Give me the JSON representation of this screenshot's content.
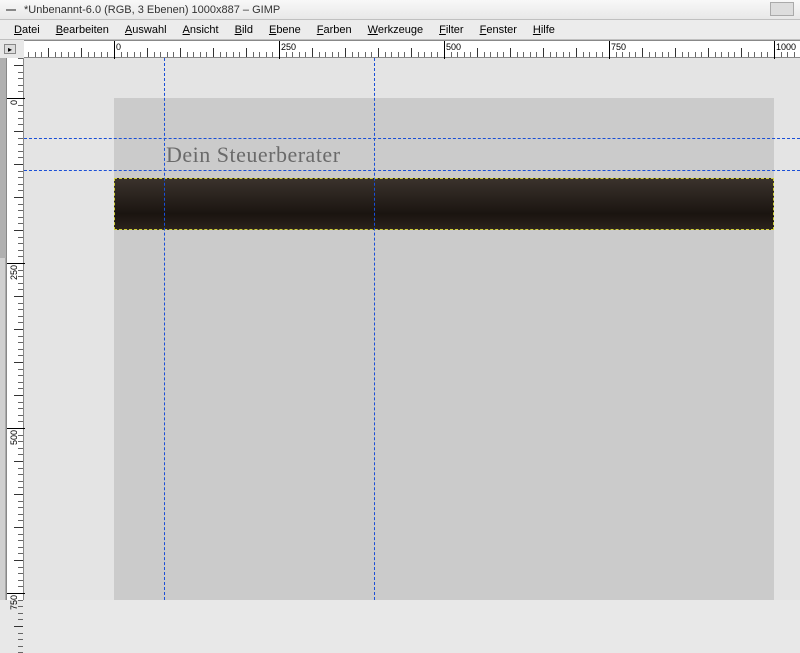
{
  "window": {
    "title": "*Unbenannt-6.0 (RGB, 3 Ebenen) 1000x887 – GIMP"
  },
  "menu": {
    "items": [
      "Datei",
      "Bearbeiten",
      "Auswahl",
      "Ansicht",
      "Bild",
      "Ebene",
      "Farben",
      "Werkzeuge",
      "Filter",
      "Fenster",
      "Hilfe"
    ]
  },
  "ruler_h": {
    "ticks": [
      {
        "pos": 0,
        "label": "0"
      },
      {
        "pos": 250,
        "label": "250"
      },
      {
        "pos": 500,
        "label": "500"
      },
      {
        "pos": 750,
        "label": "750"
      },
      {
        "pos": 1000,
        "label": "1000"
      }
    ]
  },
  "ruler_v": {
    "ticks": [
      {
        "pos": 0,
        "label": "0"
      },
      {
        "pos": 250,
        "label": "250"
      },
      {
        "pos": 500,
        "label": "500"
      }
    ]
  },
  "canvas": {
    "heading": "Dein Steuerberater"
  },
  "guides": {
    "horizontal": [
      80,
      112
    ],
    "vertical": [
      140,
      350
    ]
  },
  "colors": {
    "guide": "#1a4fd6",
    "selection_dash": "#cfcf3a",
    "bar_dark": "#1a1410",
    "canvas_bg": "#cbcbcb"
  }
}
